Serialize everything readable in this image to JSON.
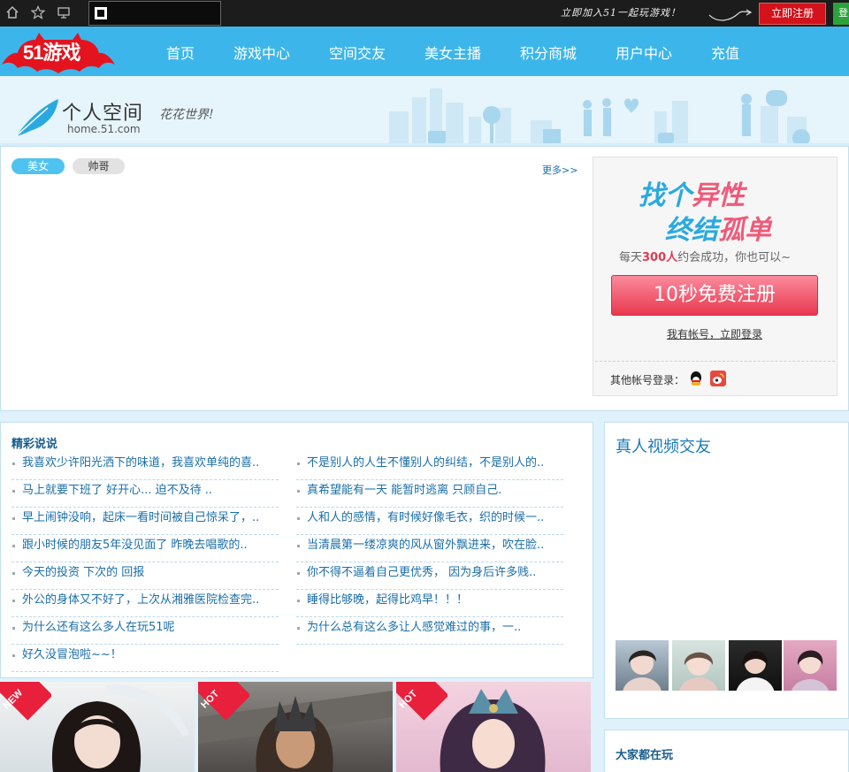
{
  "topbar": {
    "slogan": "立即加入51一起玩游戏！",
    "register_label": "立即注册",
    "green_label": "登"
  },
  "nav": {
    "logo": "51游戏",
    "items": [
      "首页",
      "游戏中心",
      "空间交友",
      "美女主播",
      "积分商城",
      "用户中心",
      "充值"
    ]
  },
  "banner": {
    "title": "个人空间",
    "domain": "home.51.com",
    "slogan": "花花世界!"
  },
  "tabs": [
    "美女",
    "帅哥"
  ],
  "more": "更多>>",
  "register_box": {
    "line1_a": "找个",
    "line1_b": "异性",
    "line2_a": "终结",
    "line2_b": "孤单",
    "sub_prefix": "每天",
    "sub_count": "300人",
    "sub_suffix": "约会成功，你也可以~",
    "button": "10秒免费注册",
    "login_link": "我有帐号，立即登录",
    "other_login": "其他帐号登录："
  },
  "talk": {
    "title": "精彩说说",
    "left": [
      "我喜欢少许阳光洒下的味道，我喜欢单纯的喜..",
      "马上就要下班了 好开心... 迫不及待 ..",
      "早上闹钟没响，起床一看时间被自己惊呆了，..",
      "跟小时候的朋友5年没见面了 昨晚去唱歌的..",
      "今天的投资   下次的 回报",
      "外公的身体又不好了，上次从湘雅医院检查完..",
      "为什么还有这么多人在玩51呢",
      "好久没冒泡啦~~！"
    ],
    "right": [
      "不是别人的人生不懂别人的纠结，不是别人的..",
      "真希望能有一天 能暂时逃离 只顾自己.",
      "人和人的感情，有时候好像毛衣，织的时候一..",
      "当清晨第一缕凉爽的风从窗外飘进来，吹在脸..",
      "你不得不逼着自己更优秀， 因为身后许多贱..",
      "睡得比够晚，起得比鸡早！！！",
      " 为什么总有这么多让人感觉难过的事，一.."
    ]
  },
  "video": {
    "title": "真人视频交友"
  },
  "play": {
    "title": "大家都在玩"
  },
  "games": [
    {
      "badge": "NEW"
    },
    {
      "badge": "HOT"
    },
    {
      "badge": "HOT"
    }
  ]
}
